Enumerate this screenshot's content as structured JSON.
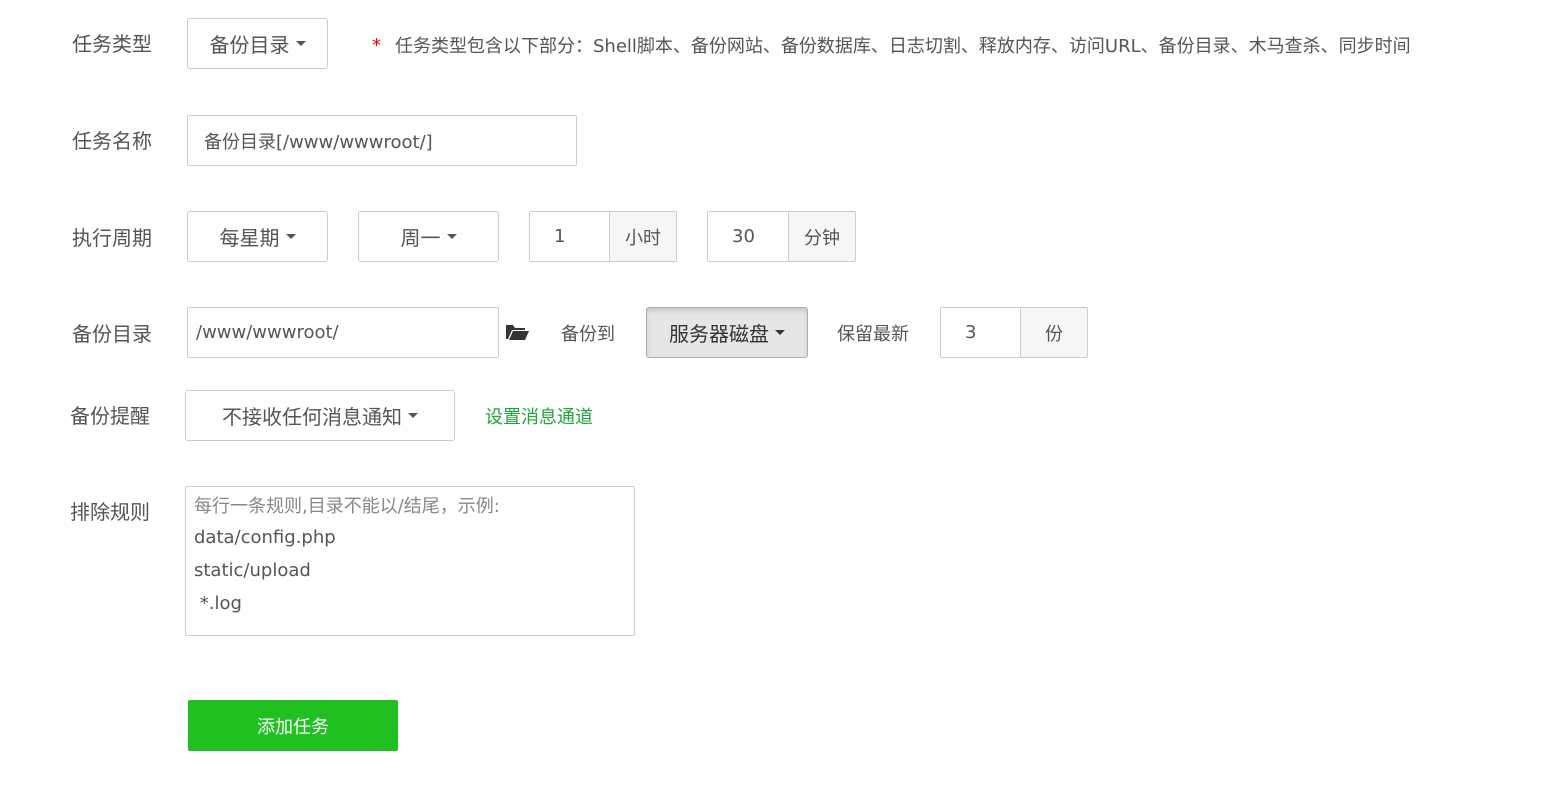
{
  "task_type": {
    "label": "任务类型",
    "value": "备份目录",
    "hint_marker": "*",
    "hint": "任务类型包含以下部分：Shell脚本、备份网站、备份数据库、日志切割、释放内存、访问URL、备份目录、木马查杀、同步时间"
  },
  "task_name": {
    "label": "任务名称",
    "value": "备份目录[/www/wwwroot/]"
  },
  "schedule": {
    "label": "执行周期",
    "period": "每星期",
    "weekday": "周一",
    "hour": "1",
    "hour_unit": "小时",
    "minute": "30",
    "minute_unit": "分钟"
  },
  "backup_dir": {
    "label": "备份目录",
    "path": "/www/wwwroot/",
    "backup_to_label": "备份到",
    "destination": "服务器磁盘",
    "keep_label": "保留最新",
    "keep_count": "3",
    "keep_unit": "份"
  },
  "backup_alert": {
    "label": "备份提醒",
    "value": "不接收任何消息通知",
    "settings_link": "设置消息通道"
  },
  "exclude_rules": {
    "label": "排除规则",
    "placeholder_lines": [
      "每行一条规则,目录不能以/结尾，示例:",
      "data/config.php",
      "static/upload",
      " *.log"
    ]
  },
  "submit_label": "添加任务",
  "colors": {
    "accent_green": "#20a53a",
    "submit_green": "#20c021",
    "required_red": "#ef0000"
  },
  "icons": {
    "folder": "folder-open-icon",
    "caret": "caret-down-icon"
  }
}
